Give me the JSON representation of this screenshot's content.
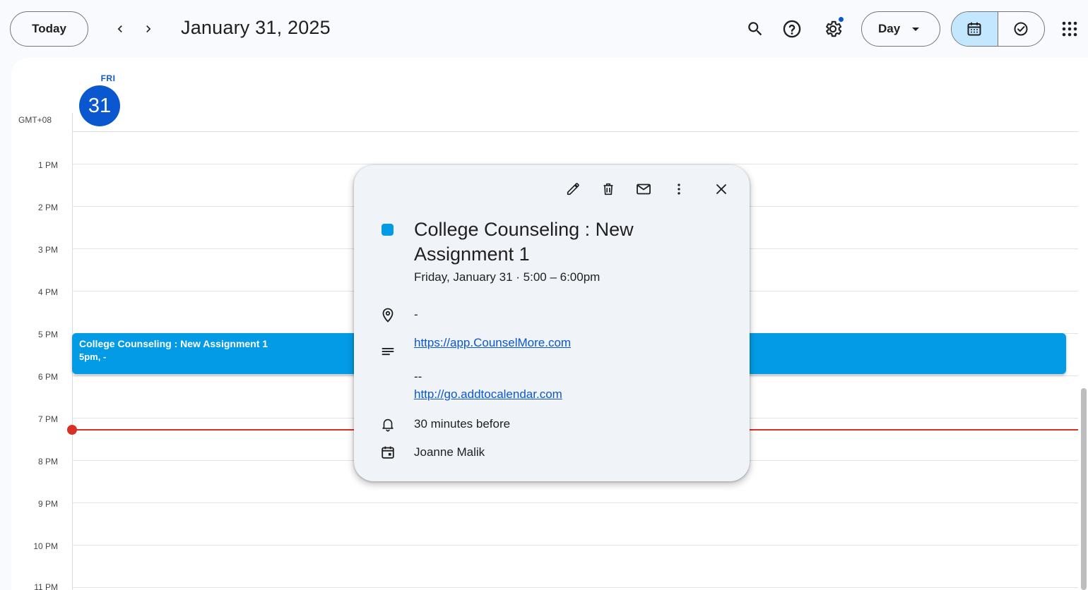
{
  "header": {
    "today_label": "Today",
    "date_title": "January 31, 2025",
    "view_label": "Day"
  },
  "day": {
    "weekday": "FRI",
    "date_number": "31",
    "timezone": "GMT+08"
  },
  "hours": [
    "1 PM",
    "2 PM",
    "3 PM",
    "4 PM",
    "5 PM",
    "6 PM",
    "7 PM",
    "8 PM",
    "9 PM",
    "10 PM",
    "11 PM"
  ],
  "event": {
    "title": "College Counseling : New Assignment 1",
    "time": "5pm, -",
    "color": "#039be5"
  },
  "popover": {
    "title": "College Counseling : New Assignment 1",
    "when": "Friday, January 31  ·  5:00 – 6:00pm",
    "location": "-",
    "description_link1": "https://app.CounselMore.com",
    "description_sep": "--",
    "description_link2": "http://go.addtocalendar.com",
    "reminder": "30 minutes before",
    "calendar_owner": "Joanne Malik"
  },
  "colors": {
    "accent": "#0b57d0",
    "event": "#039be5",
    "now_line": "#d93025",
    "segment_active": "#c2e7ff"
  },
  "icons": {
    "nav_prev": "chevron-left-icon",
    "nav_next": "chevron-right-icon",
    "search": "search-icon",
    "help": "help-icon",
    "settings": "gear-icon",
    "calendar_view": "calendar-icon",
    "tasks_view": "check-circle-icon",
    "apps": "apps-grid-icon",
    "edit": "pencil-icon",
    "delete": "trash-icon",
    "email": "mail-icon",
    "more": "more-vert-icon",
    "close": "close-icon",
    "location": "location-pin-icon",
    "description": "notes-icon",
    "reminder": "bell-icon",
    "calendar": "calendar-event-icon"
  }
}
